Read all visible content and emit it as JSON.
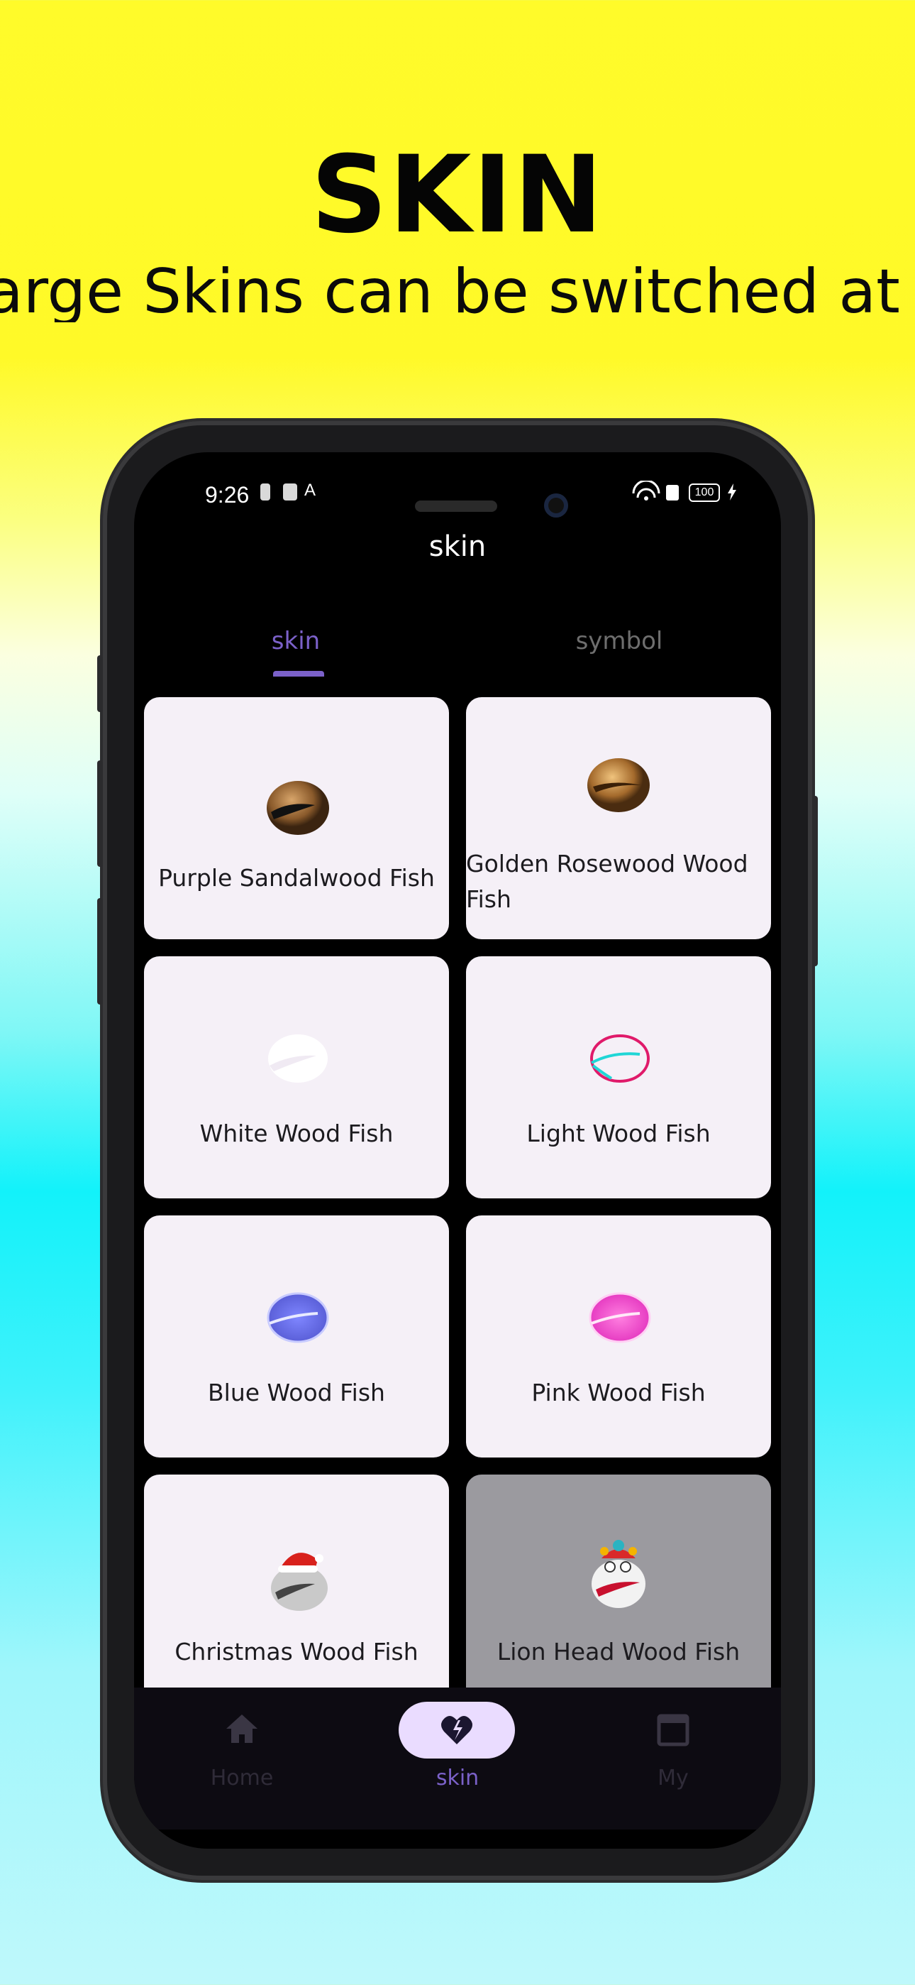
{
  "banner": {
    "headline": "SKIN",
    "subline": "arge Skins can be switched at w"
  },
  "status_bar": {
    "time": "9:26",
    "battery": "100"
  },
  "app": {
    "title": "skin",
    "tabs": [
      {
        "label": "skin",
        "active": true
      },
      {
        "label": "symbol",
        "active": false
      }
    ]
  },
  "skins": [
    {
      "name": "Purple Sandalwood Fish",
      "icon": "brown-wood-fish-icon",
      "selected": false
    },
    {
      "name": "Golden Rosewood Wood Fish",
      "icon": "golden-wood-fish-icon",
      "selected": false
    },
    {
      "name": "White Wood Fish",
      "icon": "white-wood-fish-icon",
      "selected": false
    },
    {
      "name": "Light Wood Fish",
      "icon": "neon-outline-wood-fish-icon",
      "selected": false
    },
    {
      "name": "Blue Wood Fish",
      "icon": "blue-glow-wood-fish-icon",
      "selected": false
    },
    {
      "name": "Pink Wood Fish",
      "icon": "pink-glow-wood-fish-icon",
      "selected": false
    },
    {
      "name": "Christmas Wood Fish",
      "icon": "santa-hat-wood-fish-icon",
      "selected": false
    },
    {
      "name": "Lion Head Wood Fish",
      "icon": "lion-head-wood-fish-icon",
      "selected": true
    }
  ],
  "bottom_nav": [
    {
      "label": "Home",
      "icon": "home-icon",
      "active": false
    },
    {
      "label": "skin",
      "icon": "broken-heart-icon",
      "active": true
    },
    {
      "label": "My",
      "icon": "profile-box-icon",
      "active": false
    }
  ],
  "colors": {
    "accent": "#7b61c9",
    "card_bg": "#f5f0f7",
    "selected_card_bg": "#9b9a9f",
    "nav_pill": "#eadcff"
  }
}
